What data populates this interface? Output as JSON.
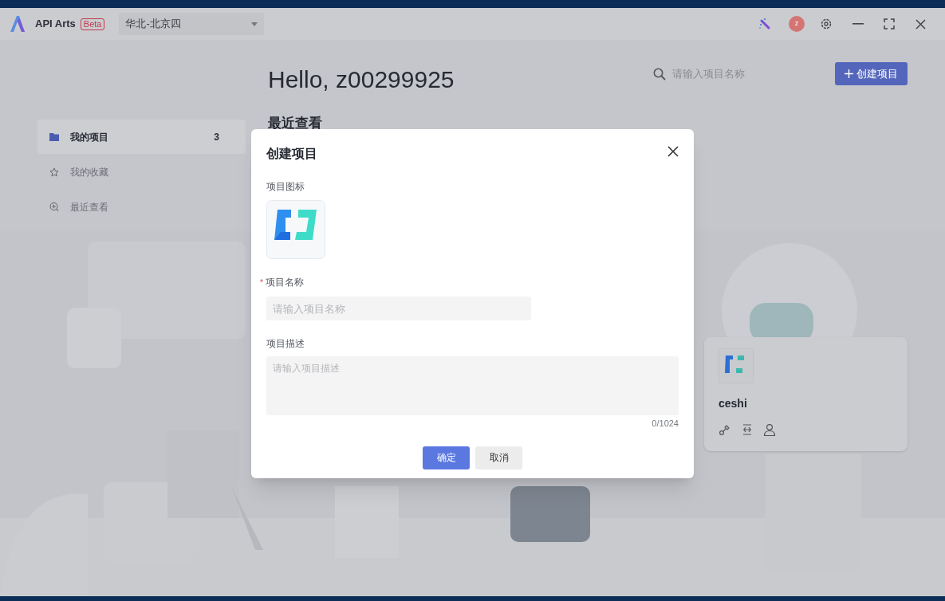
{
  "app": {
    "name": "API Arts",
    "badge": "Beta"
  },
  "region_select": {
    "value": "华北-北京四"
  },
  "title_bar": {
    "avatar": "z"
  },
  "greeting": "Hello, z00299925",
  "search": {
    "placeholder": "请输入项目名称"
  },
  "create_button": {
    "label": "创建项目"
  },
  "sidebar": {
    "items": [
      {
        "kind": "folder",
        "label": "我的项目",
        "count": "3",
        "selected": true
      },
      {
        "kind": "star",
        "label": "我的收藏",
        "selected": false
      },
      {
        "kind": "recent",
        "label": "最近查看",
        "selected": false
      }
    ]
  },
  "section_heading": "最近查看",
  "project_card": {
    "name": "ceshi"
  },
  "dialog": {
    "title": "创建项目",
    "icon_label": "项目图标",
    "name_label": "项目名称",
    "required_mark": "*",
    "name_placeholder": "请输入项目名称",
    "desc_label": "项目描述",
    "desc_placeholder": "请输入项目描述",
    "counter": "0/1024",
    "buttons": [
      {
        "label": "确定",
        "kind": "primary"
      },
      {
        "label": "取消",
        "kind": "secondary"
      }
    ]
  }
}
